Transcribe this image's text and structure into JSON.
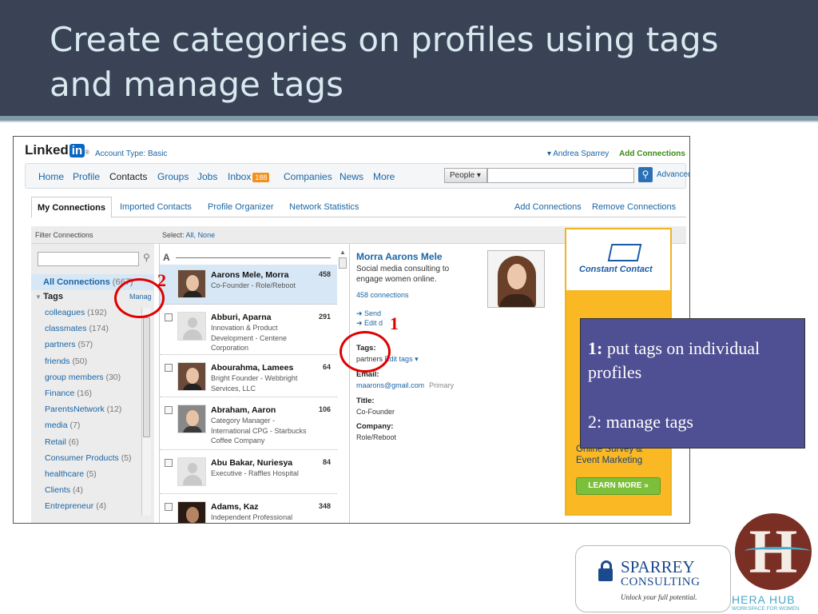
{
  "slide": {
    "title": "Create categories on profiles using tags and manage tags"
  },
  "linkedin": {
    "logo_text": "Linked",
    "logo_in": "in",
    "account_type": "Account Type: Basic",
    "user_name": "▾ Andrea Sparrey",
    "add_connections_top": "Add Connections",
    "nav": {
      "home": "Home",
      "profile": "Profile",
      "contacts": "Contacts",
      "groups": "Groups",
      "jobs": "Jobs",
      "inbox": "Inbox",
      "inbox_count": "188",
      "companies": "Companies",
      "news": "News",
      "more": "More",
      "people_select": "People ▾",
      "search_value": "",
      "advanced": "Advanced"
    },
    "tabs": {
      "my_connections": "My Connections",
      "imported_contacts": "Imported Contacts",
      "profile_organizer": "Profile Organizer",
      "network_statistics": "Network Statistics",
      "add_connections": "Add Connections",
      "remove_connections": "Remove Connections"
    },
    "filter": {
      "label": "Filter Connections",
      "select_prefix": "Select:",
      "select_all": "All,",
      "select_none": "None",
      "input_value": "",
      "all_connections": "All Connections",
      "all_connections_count": "(667)",
      "tags_heading": "Tags",
      "manage_link": "Manage",
      "tags": [
        {
          "name": "colleagues",
          "count": "(192)"
        },
        {
          "name": "classmates",
          "count": "(174)"
        },
        {
          "name": "partners",
          "count": "(57)"
        },
        {
          "name": "friends",
          "count": "(50)"
        },
        {
          "name": "group members",
          "count": "(30)"
        },
        {
          "name": "Finance",
          "count": "(16)"
        },
        {
          "name": "ParentsNetwork",
          "count": "(12)"
        },
        {
          "name": "media",
          "count": "(7)"
        },
        {
          "name": "Retail",
          "count": "(6)"
        },
        {
          "name": "Consumer Products",
          "count": "(5)"
        },
        {
          "name": "healthcare",
          "count": "(5)"
        },
        {
          "name": "Clients",
          "count": "(4)"
        },
        {
          "name": "Entrepreneur",
          "count": "(4)"
        }
      ]
    },
    "list": {
      "letter": "A",
      "rows": [
        {
          "name": "Aarons Mele, Morra",
          "title": "Co-Founder - Role/Reboot",
          "count": "458"
        },
        {
          "name": "Abburi, Aparna",
          "title": "Innovation & Product Development - Centene Corporation",
          "count": "291"
        },
        {
          "name": "Abourahma, Lamees",
          "title": "Bright Founder - Webbright Services, LLC",
          "count": "64"
        },
        {
          "name": "Abraham, Aaron",
          "title": "Category Manager - International CPG - Starbucks Coffee Company",
          "count": "106"
        },
        {
          "name": "Abu Bakar, Nuriesya",
          "title": "Executive - Raffles Hospital",
          "count": "84"
        },
        {
          "name": "Adams, Kaz",
          "title": "Independent Professional",
          "count": "348"
        }
      ]
    },
    "profile": {
      "name": "Morra Aarons Mele",
      "headline": "Social media consulting to engage women online.",
      "connections": "458 connections",
      "action_send": "Send",
      "action_edit": "Edit d",
      "tags_label": "Tags:",
      "tags_value": "partners",
      "edit_tags": "Edit tags ▾",
      "email_label": "Email:",
      "email_value": "maarons@gmail.com",
      "email_primary": "Primary",
      "title_label": "Title:",
      "title_value": "Co-Founder",
      "company_label": "Company:",
      "company_value": "Role/Reboot"
    },
    "ad": {
      "brand": "Constant Contact",
      "text": "Online Survey & Event Marketing",
      "button": "LEARN MORE »"
    }
  },
  "annotations": {
    "label_1": "1",
    "label_2": "2",
    "callout_1_num": "1:",
    "callout_1_text": "put tags on individual profiles",
    "callout_2_text": "2: manage tags",
    "color": "#e00000"
  },
  "logos": {
    "sparrey_name": "SPARREY",
    "sparrey_sub": "CONSULTING",
    "sparrey_tagline": "Unlock your full potential.",
    "hera_letter": "H",
    "hera_name": "HERA HUB",
    "hera_sub": "WORKSPACE FOR WOMEN"
  }
}
